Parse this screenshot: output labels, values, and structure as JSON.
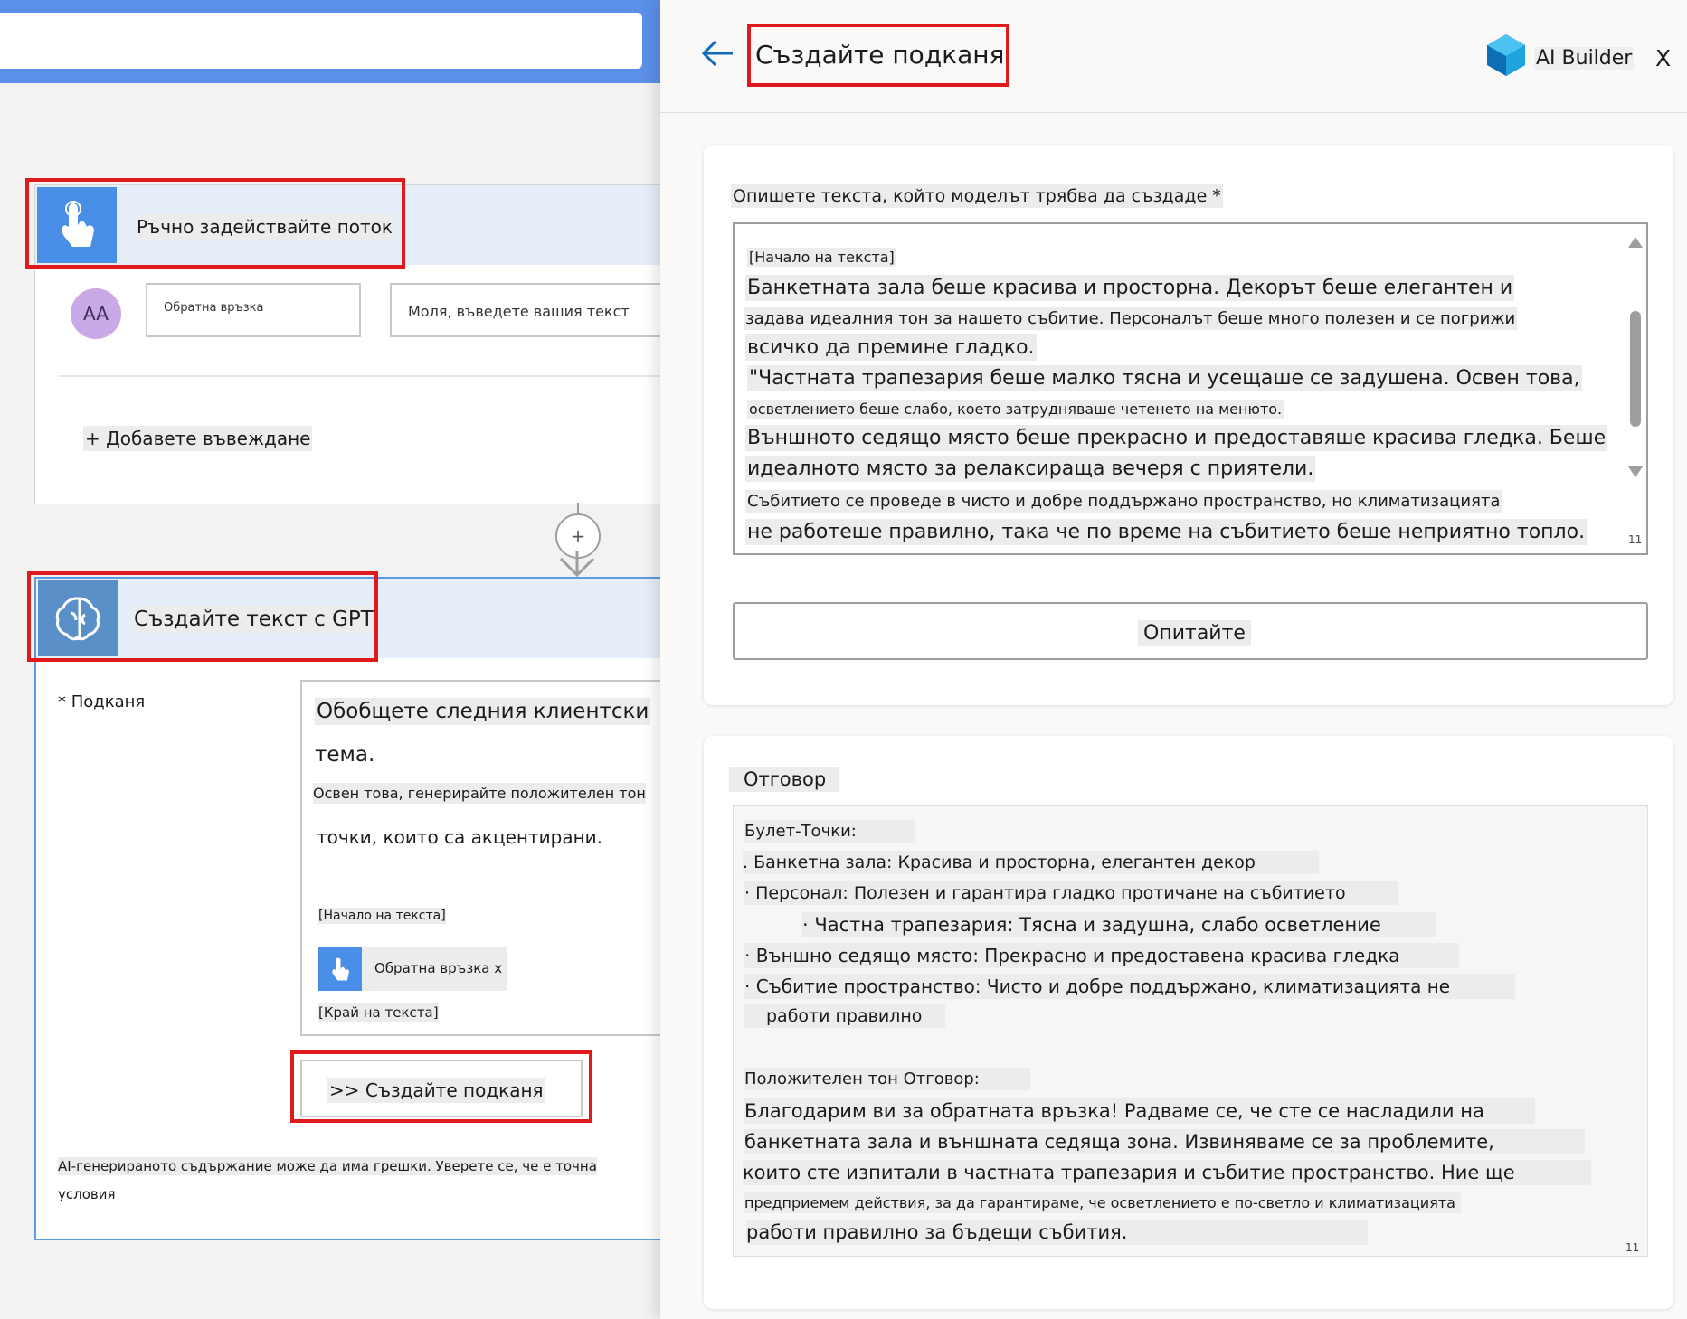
{
  "flow": {
    "trigger": {
      "title": "Ръчно задействайте поток",
      "avatar": "AA",
      "field_label": "Обратна връзка",
      "field_placeholder": "Моля, въведете вашия текст",
      "add_input": "+ Добавете въвеждане"
    },
    "insert_step": "+",
    "gpt_action": {
      "title": "Създайте текст с GPT",
      "prompt_label": "* Подканя",
      "prompt_lines": [
        "Обобщете следния клиентски",
        "тема.",
        "Освен това, генерирайте положителен тон",
        "точки, които са акцентирани."
      ],
      "text_start": "[Начало на текста]",
      "token_label": "Обратна връзка x",
      "text_end": "[Край на текста]",
      "create_prompt_button": ">> Създайте подканя",
      "disclaimer_line1": "AI-генерираното съдържание може да има грешки. Уверете се, че е точна",
      "disclaimer_line2": "условия"
    }
  },
  "panel": {
    "title": "Създайте подканя",
    "brand": "AI Builder",
    "close": "X",
    "prompt_section": {
      "label": "Опишете текста, който моделът трябва да създаде *",
      "lines": [
        "[Начало на текста]",
        "Банкетната зала беше красива и просторна. Декорът беше елегантен и",
        "задава идеалния тон за нашето събитие. Персоналът беше много полезен и се погрижи",
        "всичко да премине гладко.",
        "\"Частната трапезария беше малко тясна и усещаше се задушена. Освен това,",
        "осветлението беше слабо, което затрудняваше четенето на менюто.",
        "Външното седящо място беше прекрасно и предоставяше красива гледка. Беше",
        "идеалното място за релаксираща вечеря с приятели.",
        "Събитието се проведе в чисто и добре поддържано пространство, но климатизацията",
        "не работеше правилно, така че по време на събитието беше неприятно топло."
      ],
      "counter": "11",
      "try_button": "Опитайте"
    },
    "response_section": {
      "label": "Отговор",
      "lines": [
        "Булет-Точки:",
        ". Банкетна зала: Красива и просторна, елегантен декор",
        "· Персонал: Полезен и гарантира гладко протичане на събитието",
        "· Частна трапезария: Тясна и задушна, слабо осветление",
        "· Външно седящо място: Прекрасно и предоставена красива гледка",
        "· Събитие пространство: Чисто и добре поддържано, климатизацията не",
        "работи правилно",
        "Положителен тон Отговор:",
        "Благодарим ви за обратната връзка! Радваме се, че сте се насладили на",
        "банкетната зала и външната седяща зона. Извиняваме се за проблемите,",
        "които сте изпитали в частната трапезария и събитие пространство. Ние ще",
        "предприемем действия, за да гарантираме, че осветлението е по-светло и климатизацията",
        "работи правилно за бъдещи събития."
      ],
      "counter": "11"
    }
  },
  "colors": {
    "accent": "#0f6cbd",
    "highlight_red": "#e0191d",
    "header_blue": "#5b8fe8",
    "icon_blue": "#4a8fe7"
  }
}
